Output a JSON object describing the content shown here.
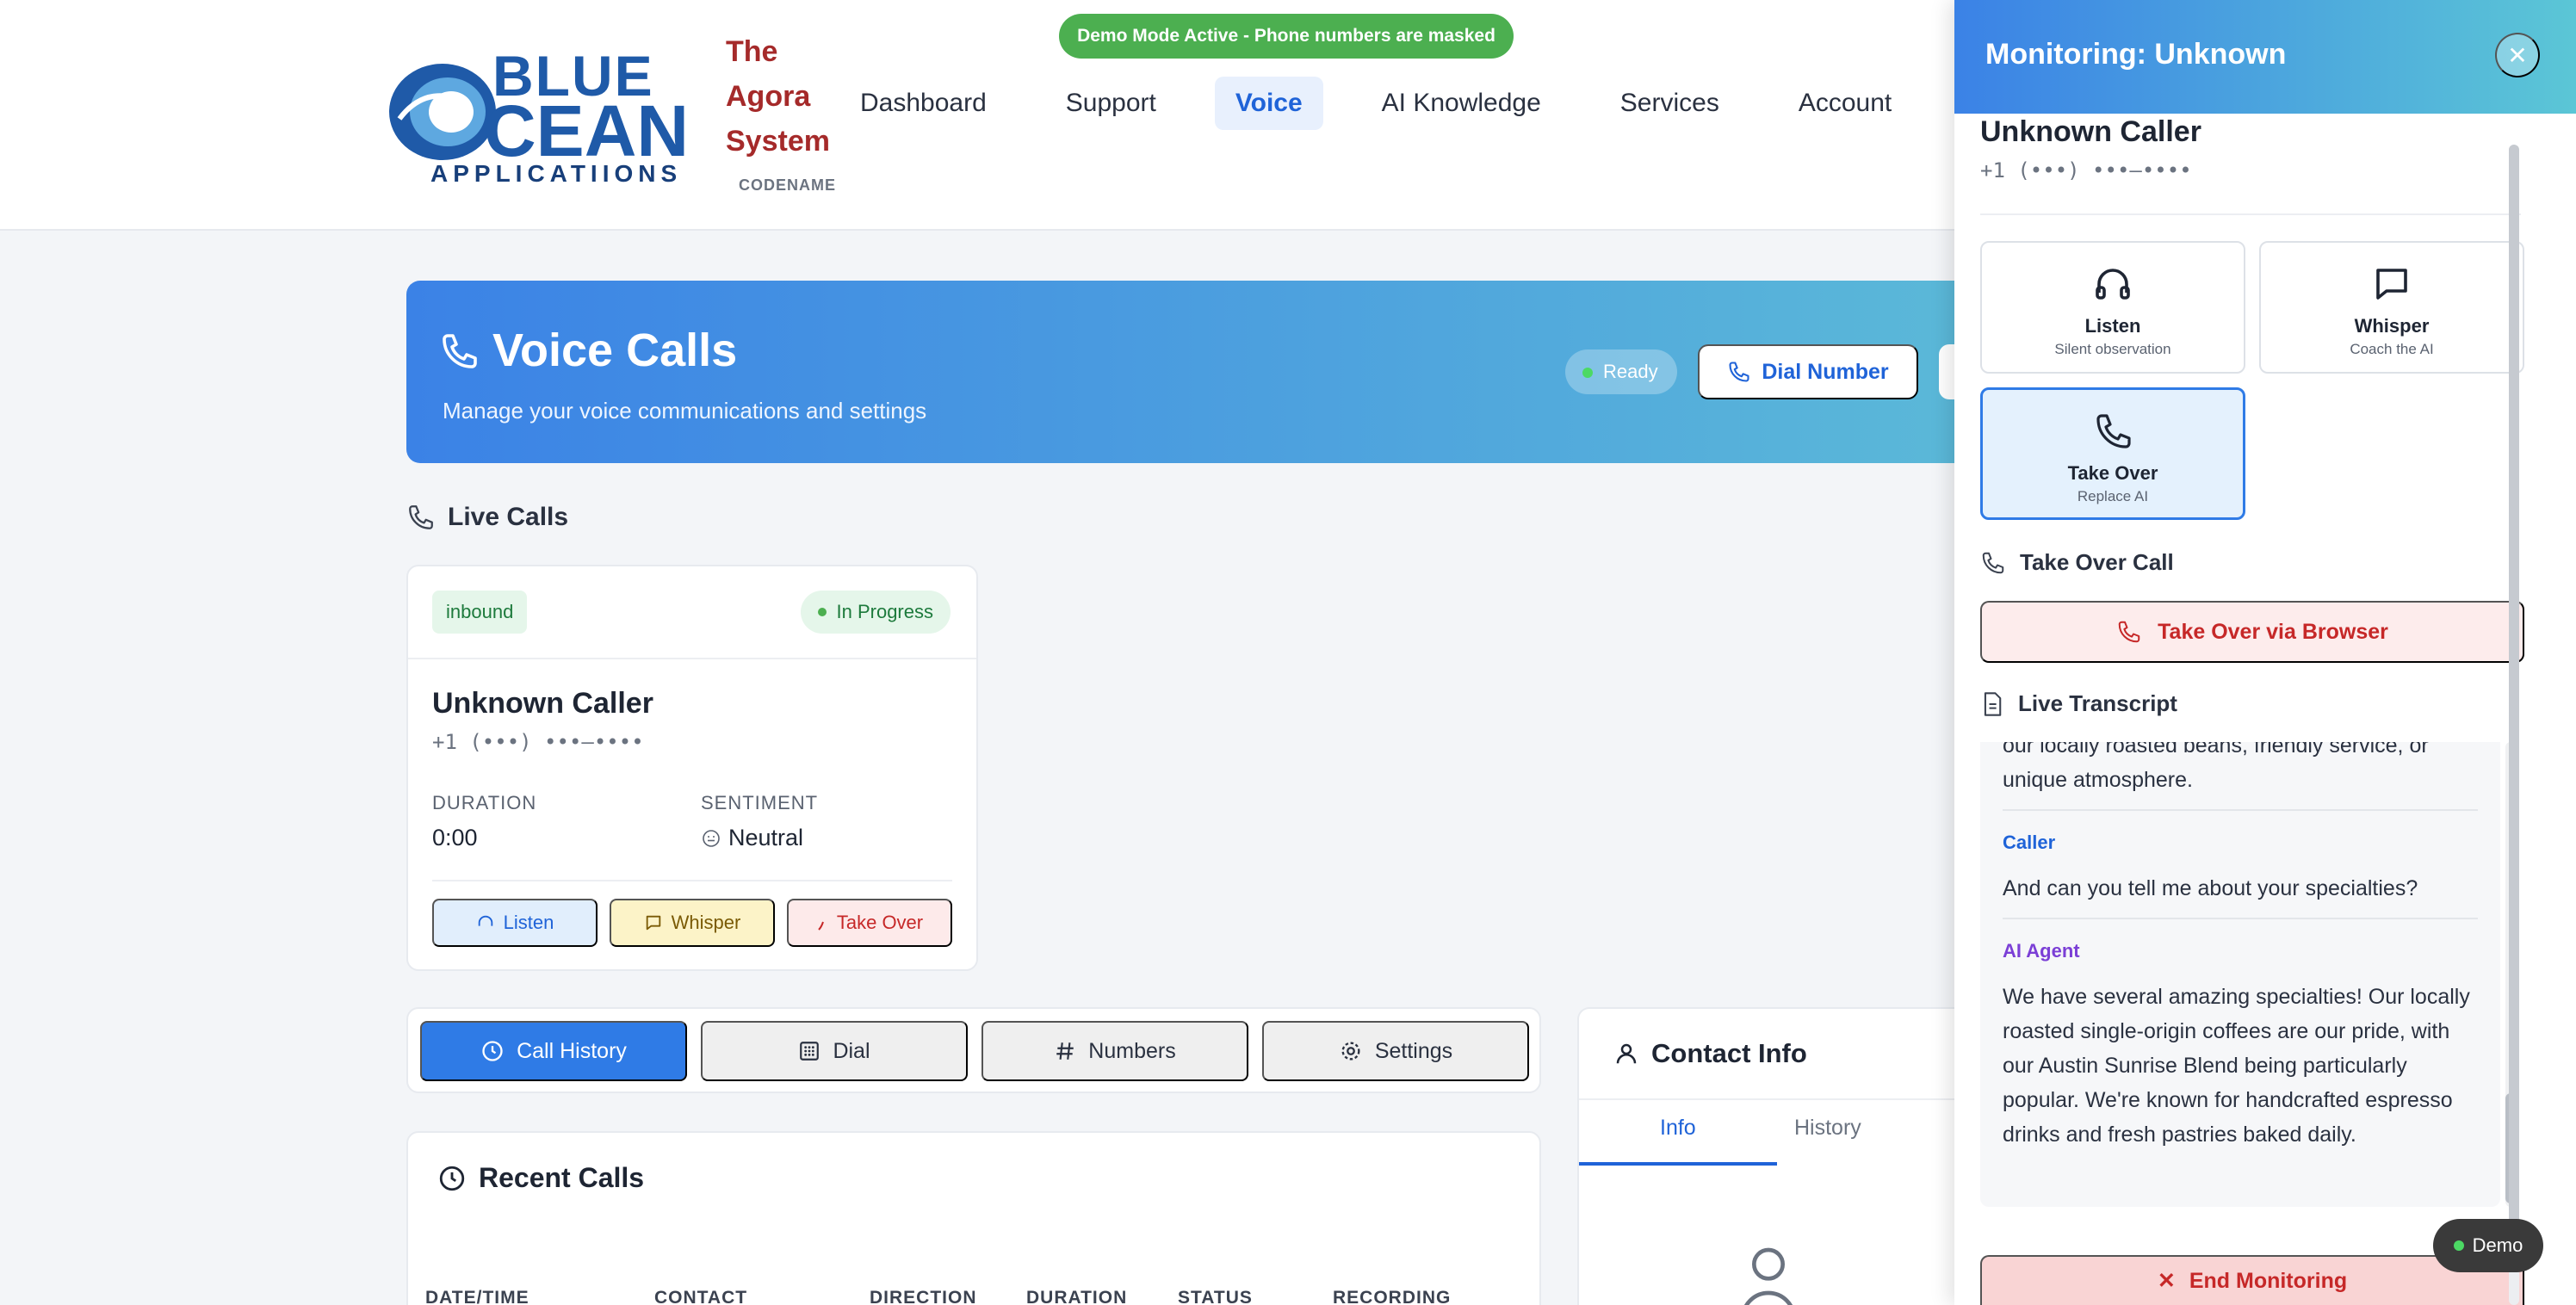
{
  "banner": {
    "text": "Demo Mode Active - Phone numbers are masked"
  },
  "brand": {
    "logo_line1": "BLUE",
    "logo_line2": "CEAN",
    "logo_line3": "APPLICATIIONS",
    "system_name_lines": [
      "The",
      "Agora",
      "System"
    ],
    "codename": "CODENAME"
  },
  "nav": {
    "items": [
      {
        "label": "Dashboard"
      },
      {
        "label": "Support"
      },
      {
        "label": "Voice",
        "active": true
      },
      {
        "label": "AI Knowledge"
      },
      {
        "label": "Services"
      },
      {
        "label": "Account"
      }
    ]
  },
  "hero": {
    "title": "Voice Calls",
    "subtitle": "Manage your voice communications and settings",
    "status": "Ready",
    "dial_label": "Dial Number"
  },
  "live_calls": {
    "heading": "Live Calls",
    "card": {
      "direction": "inbound",
      "status": "In Progress",
      "caller": "Unknown Caller",
      "phone": "+1 (•••) •••–••••",
      "duration_label": "DURATION",
      "duration": "0:00",
      "sentiment_label": "SENTIMENT",
      "sentiment": "Neutral",
      "actions": {
        "listen": "Listen",
        "whisper": "Whisper",
        "takeover": "Take Over"
      }
    }
  },
  "tabs": [
    {
      "label": "Call History",
      "active": true
    },
    {
      "label": "Dial"
    },
    {
      "label": "Numbers"
    },
    {
      "label": "Settings"
    }
  ],
  "recent_calls": {
    "title": "Recent Calls",
    "columns": [
      "DATE/TIME",
      "CONTACT",
      "DIRECTION",
      "DURATION",
      "STATUS",
      "RECORDING"
    ]
  },
  "contact_info": {
    "title": "Contact Info",
    "tabs": [
      {
        "label": "Info",
        "active": true
      },
      {
        "label": "History"
      }
    ]
  },
  "monitor": {
    "title": "Monitoring: Unknown",
    "caller": "Unknown Caller",
    "phone": "+1 (•••) •••–••••",
    "modes": [
      {
        "name": "Listen",
        "desc": "Silent observation"
      },
      {
        "name": "Whisper",
        "desc": "Coach the AI"
      },
      {
        "name": "Take Over",
        "desc": "Replace AI",
        "active": true
      }
    ],
    "takeover_heading": "Take Over Call",
    "takeover_browser": "Take Over via Browser",
    "transcript_heading": "Live Transcript",
    "transcript": [
      {
        "speaker": "",
        "text": "our locally roasted beans, friendly service, or unique atmosphere."
      },
      {
        "speaker": "Caller",
        "text": "And can you tell me about your specialties?"
      },
      {
        "speaker": "AI Agent",
        "text": "We have several amazing specialties! Our locally roasted single-origin coffees are our pride, with our Austin Sunrise Blend being particularly popular. We're known for handcrafted espresso drinks and fresh pastries baked daily."
      }
    ],
    "end_label": "End Monitoring"
  },
  "demo_chip": "Demo",
  "colors": {
    "accent": "#2f7be6",
    "success": "#4caf50",
    "danger": "#c62828",
    "brand": "#1f5aa8"
  }
}
